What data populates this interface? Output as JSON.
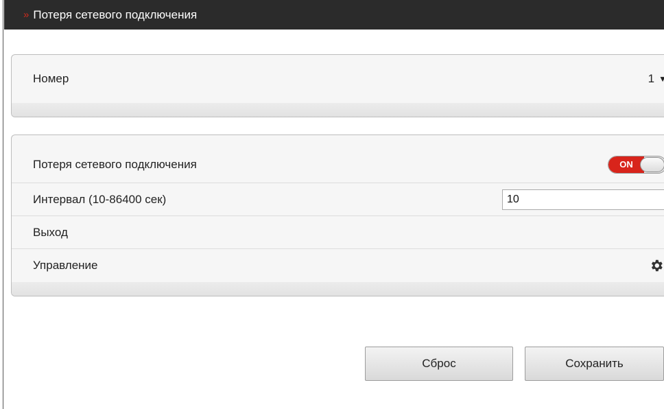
{
  "header": {
    "chevron": "»",
    "title": "Потеря сетевого подключения"
  },
  "number_panel": {
    "label": "Номер",
    "value": "1",
    "dropdown_icon": "caret-down-icon"
  },
  "settings_panel": {
    "loss_label": "Потеря сетевого подключения",
    "toggle_state": "ON",
    "interval_label": "Интервал (10-86400 сек)",
    "interval_value": "10",
    "output_label": "Выход",
    "control_label": "Управление",
    "control_icon": "gear-icon"
  },
  "buttons": {
    "reset_label": "Сброс",
    "save_label": "Сохранить"
  },
  "colors": {
    "header_bg": "#2b2b2b",
    "accent_red": "#d8241b"
  }
}
